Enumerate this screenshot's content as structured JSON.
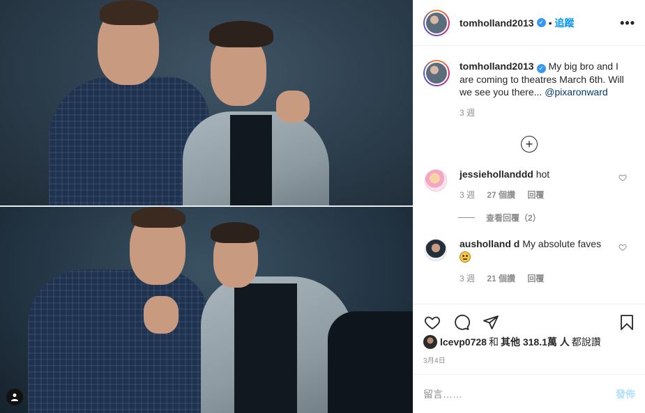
{
  "post": {
    "author": "tomholland2013",
    "follow_label": "追蹤",
    "header_sep": "•",
    "more_label": "•••",
    "caption": {
      "username": "tomholland2013",
      "text": "My big bro and I are coming to theatres March 6th. Will we see you there... ",
      "mention": "@pixaronward",
      "time": "3 週"
    },
    "load_more_label": "+",
    "comments": [
      {
        "username": "jessiehollanddd",
        "text": "hot",
        "time": "3 週",
        "likes": "27 個讚",
        "reply_label": "回覆",
        "view_replies": "查看回覆（2）"
      },
      {
        "username": "ausholland d",
        "text": "My absolute faves",
        "emoji_icon": "expressionless-face-emoji",
        "time": "3 週",
        "likes": "21 個讚",
        "reply_label": "回覆"
      }
    ],
    "likes": {
      "first_user": "lcevp0728",
      "and": "和",
      "others": "其他 318.1萬 人",
      "suffix": "都說讚"
    },
    "date": "3月4日",
    "comment_placeholder": "留言……",
    "post_button": "發佈"
  },
  "colors": {
    "link": "#0095f6",
    "verified": "#3897f0",
    "muted": "#8e8e8e",
    "post_disabled": "#b2dffc"
  }
}
